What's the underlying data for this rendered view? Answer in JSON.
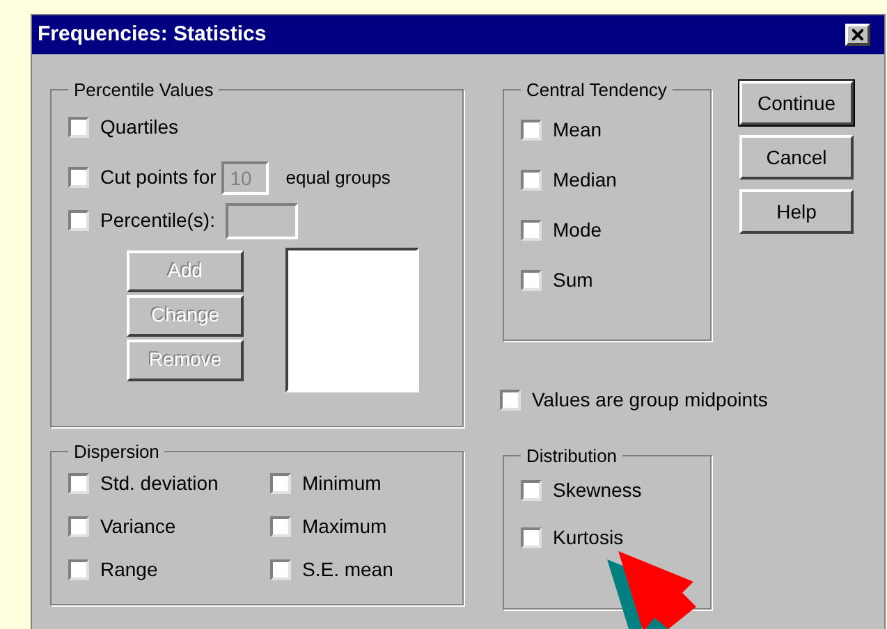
{
  "window": {
    "title": "Frequencies: Statistics"
  },
  "percentile_values": {
    "title": "Percentile Values",
    "quartiles": {
      "label": "Quartiles",
      "checked": false
    },
    "cut_points": {
      "label": "Cut points for",
      "value": "10",
      "suffix": "equal groups",
      "checked": false
    },
    "percentiles": {
      "label": "Percentile(s):",
      "checked": false
    },
    "buttons": [
      {
        "label": "Add",
        "disabled": true
      },
      {
        "label": "Change",
        "disabled": true
      },
      {
        "label": "Remove",
        "disabled": true
      }
    ]
  },
  "central_tendency": {
    "title": "Central Tendency",
    "items": [
      {
        "label": "Mean",
        "checked": false
      },
      {
        "label": "Median",
        "checked": false
      },
      {
        "label": "Mode",
        "checked": false
      },
      {
        "label": "Sum",
        "checked": false
      }
    ]
  },
  "buttons": [
    {
      "label": "Continue",
      "default": true
    },
    {
      "label": "Cancel",
      "default": false
    },
    {
      "label": "Help",
      "default": false
    }
  ],
  "group_midpoints": {
    "label": "Values are group midpoints",
    "checked": false
  },
  "dispersion": {
    "title": "Dispersion",
    "items": [
      {
        "label": "Std. deviation",
        "checked": false
      },
      {
        "label": "Minimum",
        "checked": false
      },
      {
        "label": "Variance",
        "checked": false
      },
      {
        "label": "Maximum",
        "checked": false
      },
      {
        "label": "Range",
        "checked": false
      },
      {
        "label": "S.E. mean",
        "checked": false
      }
    ]
  },
  "distribution": {
    "title": "Distribution",
    "items": [
      {
        "label": "Skewness",
        "checked": false
      },
      {
        "label": "Kurtosis",
        "checked": false
      }
    ]
  }
}
